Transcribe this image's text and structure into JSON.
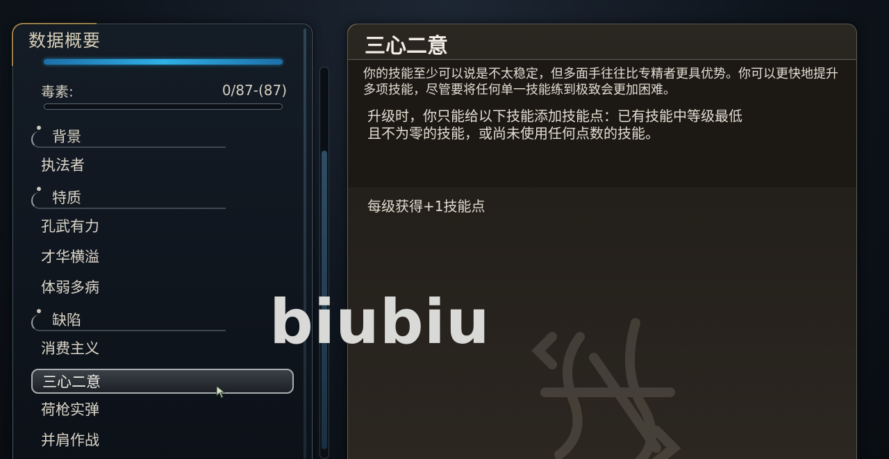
{
  "left": {
    "title": "数据概要",
    "stat": {
      "label": "毒素:",
      "value": "0/87-(87)"
    },
    "sections": {
      "background": {
        "label": "背景",
        "items": [
          "执法者"
        ]
      },
      "traits": {
        "label": "特质",
        "items": [
          "孔武有力",
          "才华横溢",
          "体弱多病"
        ]
      },
      "flaws": {
        "label": "缺陷",
        "items": [
          "消费主义",
          "三心二意",
          "荷枪实弹",
          "并肩作战"
        ]
      }
    },
    "selected": "三心二意"
  },
  "detail": {
    "title": "三心二意",
    "description": "你的技能至少可以说是不太稳定，但多面手往往比专精者更具优势。你可以更快地提升多项技能，尽管要将任何单一技能练到极致会更加困难。",
    "rule": "升级时，你只能给以下技能添加技能点：已有技能中等级最低且不为零的技能，或尚未使用任何点数的技能。",
    "gain": "每级获得+1技能点"
  },
  "watermark": "biubiu",
  "colors": {
    "accent_gold": "#a88a4e",
    "bar_blue": "#2fb0e6"
  }
}
